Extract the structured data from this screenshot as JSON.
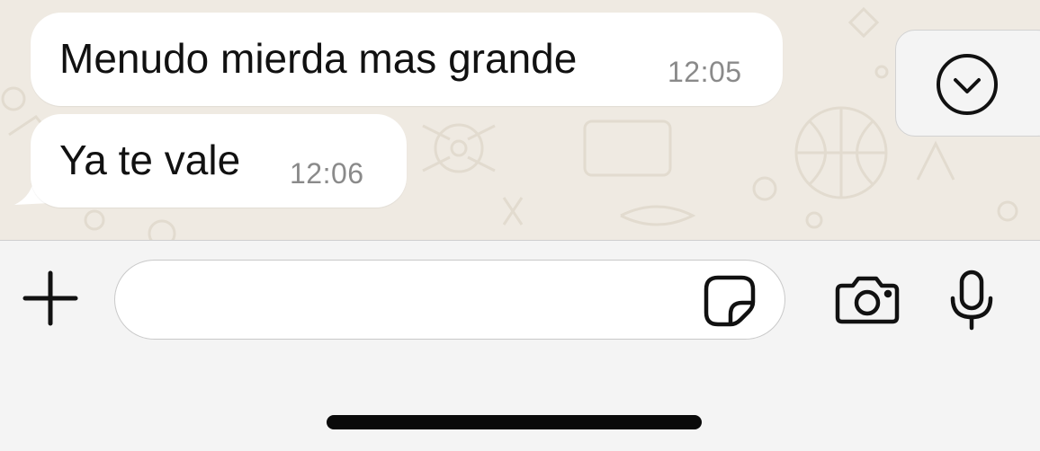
{
  "conversation": {
    "messages": [
      {
        "text": "Menudo mierda mas grande",
        "time": "12:05"
      },
      {
        "text": "Ya te vale",
        "time": "12:06"
      }
    ]
  },
  "composer": {
    "message_value": "",
    "message_placeholder": ""
  },
  "icons": {
    "scroll_down": "chevron-down-circle-icon",
    "attach": "plus-icon",
    "sticker": "sticker-icon",
    "camera": "camera-icon",
    "microphone": "microphone-icon"
  },
  "colors": {
    "chat_background": "#efeae2",
    "bubble": "#ffffff",
    "composer_background": "#f4f4f4",
    "timestamp": "#8a8a8a"
  }
}
